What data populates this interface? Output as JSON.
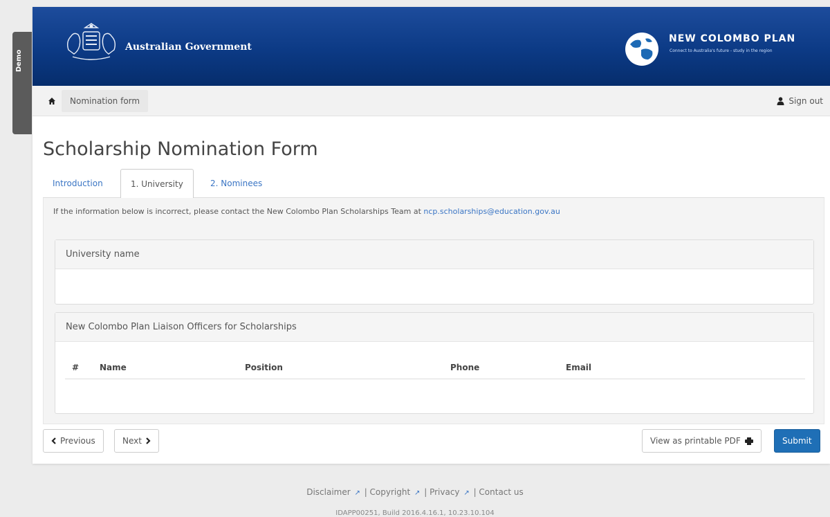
{
  "demo_tab": {
    "label": "Demo"
  },
  "header": {
    "gov_name": "Australian Government",
    "program_title": "NEW COLOMBO PLAN",
    "program_tagline": "Connect to Australia's future - study in the region",
    "accent": "#0c3a85"
  },
  "nav": {
    "breadcrumb": "Nomination form",
    "sign_out": "Sign out"
  },
  "page_title": "Scholarship Nomination Form",
  "tabs": [
    {
      "label": "Introduction",
      "active": false
    },
    {
      "label": "1. University",
      "active": true
    },
    {
      "label": "2. Nominees",
      "active": false
    }
  ],
  "info": {
    "text": "If the information below is incorrect, please contact the New Colombo Plan Scholarships Team at",
    "email": "ncp.scholarships@education.gov.au"
  },
  "university_panel": {
    "heading": "University name",
    "value": ""
  },
  "officers_panel": {
    "heading": "New Colombo Plan Liaison Officers for Scholarships",
    "columns": [
      "#",
      "Name",
      "Position",
      "Phone",
      "Email"
    ],
    "rows": []
  },
  "actions": {
    "previous": "Previous",
    "next": "Next",
    "view_pdf": "View as printable PDF",
    "submit": "Submit",
    "submit_color": "#1f6fb6"
  },
  "footer": {
    "links": [
      "Disclaimer",
      "Copyright",
      "Privacy",
      "Contact us"
    ],
    "build": "IDAPP00251, Build 2016.4.16.1, 10.23.10.104"
  }
}
